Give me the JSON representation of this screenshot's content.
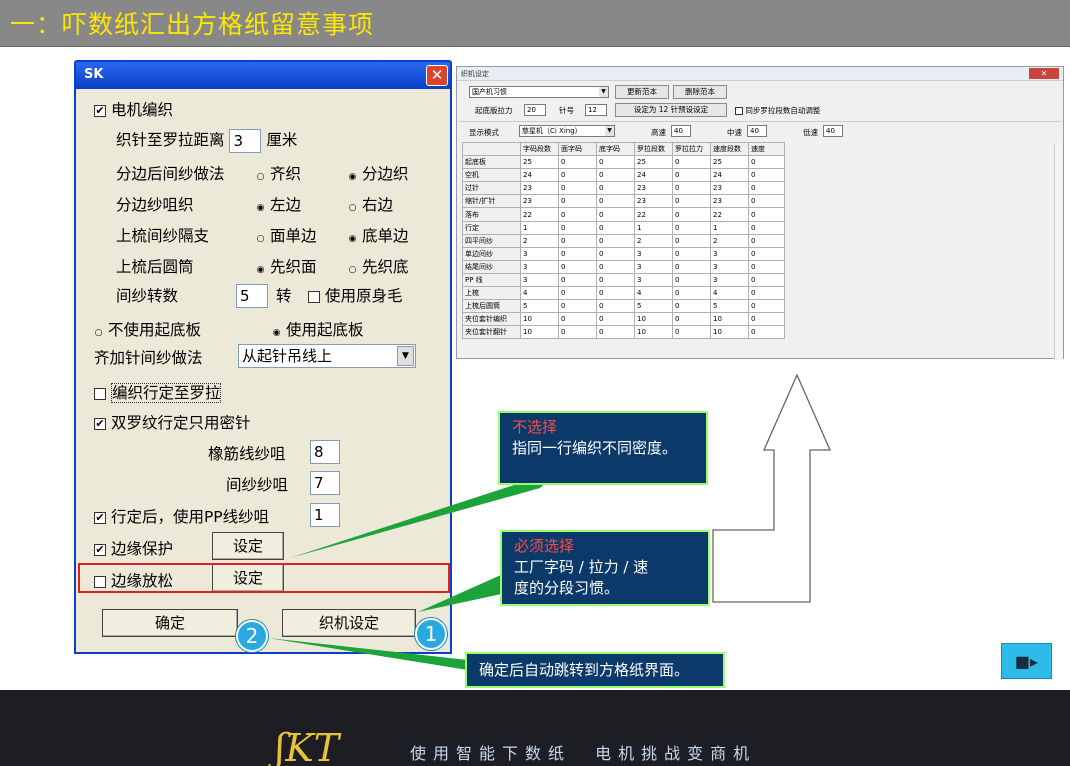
{
  "page": {
    "title": "一：吓数纸汇出方格纸留意事项"
  },
  "dialog": {
    "title": "SK",
    "close_glyph": "✕",
    "motor_knit": "电机编织",
    "needle_dist_label": "织针至罗拉距离",
    "needle_dist_value": "3",
    "needle_dist_unit": "厘米",
    "split_label": "分边后间纱做法",
    "split_opt1": "齐织",
    "split_opt2": "分边织",
    "splitzu_label": "分边纱咀织",
    "splitzu_opt1": "左边",
    "splitzu_opt2": "右边",
    "comb_label": "上梳间纱隔支",
    "comb_opt1": "面单边",
    "comb_opt2": "底单边",
    "tube_label": "上梳后圆筒",
    "tube_opt1": "先织面",
    "tube_opt2": "先织底",
    "turns_label": "间纱转数",
    "turns_value": "5",
    "turns_unit": "转",
    "use_body_yarn": "使用原身毛",
    "no_start_plate": "不使用起底板",
    "use_start_plate": "使用起底板",
    "add_needle_label": "齐加针间纱做法",
    "add_needle_value": "从起针吊线上",
    "row_to_roller": "编织行定至罗拉",
    "double_rib": "双罗纹行定只用密针",
    "rubber_label": "橡筋线纱咀",
    "rubber_value": "8",
    "waste_label": "间纱纱咀",
    "waste_value": "7",
    "pp_label": "行定后，使用PP线纱咀",
    "pp_value": "1",
    "edge_protect": "边缘保护",
    "edge_protect_btn": "设定",
    "edge_relax": "边缘放松",
    "edge_relax_btn": "设定",
    "ok_btn": "确定",
    "machine_btn": "织机设定"
  },
  "mini": {
    "title": "织机设定",
    "close_glyph": "✕",
    "habit_value": "国产机习惯",
    "update_btn": "更新范本",
    "delete_btn": "删除范本",
    "start_tension_label": "起底版拉力",
    "start_tension_value": "20",
    "needle_label": "针号",
    "needle_value": "12",
    "preset_btn": "设定为 12 针预设设定",
    "sync_label": "同步罗拉段数自动调整",
    "display_mode_label": "显示模式",
    "display_mode_value": "慈星机（Ci Xing）",
    "high_label": "高速",
    "high_value": "40",
    "mid_label": "中速",
    "mid_value": "40",
    "low_label": "低速",
    "low_value": "40",
    "headers": [
      "",
      "字码段数",
      "面字码",
      "底字码",
      "罗拉段数",
      "罗拉拉力",
      "速度段数",
      "速度"
    ],
    "rows": [
      [
        "起底板",
        "25",
        "0",
        "0",
        "25",
        "0",
        "25",
        "0"
      ],
      [
        "空机",
        "24",
        "0",
        "0",
        "24",
        "0",
        "24",
        "0"
      ],
      [
        "过针",
        "23",
        "0",
        "0",
        "23",
        "0",
        "23",
        "0"
      ],
      [
        "缩针/扩针",
        "23",
        "0",
        "0",
        "23",
        "0",
        "23",
        "0"
      ],
      [
        "落布",
        "22",
        "0",
        "0",
        "22",
        "0",
        "22",
        "0"
      ],
      [
        "行定",
        "1",
        "0",
        "0",
        "1",
        "0",
        "1",
        "0"
      ],
      [
        "四平间纱",
        "2",
        "0",
        "0",
        "2",
        "0",
        "2",
        "0"
      ],
      [
        "单边间纱",
        "3",
        "0",
        "0",
        "3",
        "0",
        "3",
        "0"
      ],
      [
        "结尾间纱",
        "3",
        "0",
        "0",
        "3",
        "0",
        "3",
        "0"
      ],
      [
        "PP 线",
        "3",
        "0",
        "0",
        "3",
        "0",
        "3",
        "0"
      ],
      [
        "上梳",
        "4",
        "0",
        "0",
        "4",
        "0",
        "4",
        "0"
      ],
      [
        "上梳后圆筒",
        "5",
        "0",
        "0",
        "5",
        "0",
        "5",
        "0"
      ],
      [
        "夹位套针编织",
        "10",
        "0",
        "0",
        "10",
        "0",
        "10",
        "0"
      ],
      [
        "夹位套针翻针",
        "10",
        "0",
        "0",
        "10",
        "0",
        "10",
        "0"
      ]
    ]
  },
  "callouts": {
    "c1_head": "不选择",
    "c1_body": "指同一行编织不同密度。",
    "c2_head": "必须选择",
    "c2_body1": "工厂字码 / 拉力 / 速",
    "c2_body2": "度的分段习惯。",
    "c3_body": "确定后自动跳转到方格纸界面。"
  },
  "badges": {
    "one": "1",
    "two": "2"
  },
  "footer": {
    "logo": "ʃKT",
    "slogan": "使用智能下数纸  电机挑战变商机"
  }
}
